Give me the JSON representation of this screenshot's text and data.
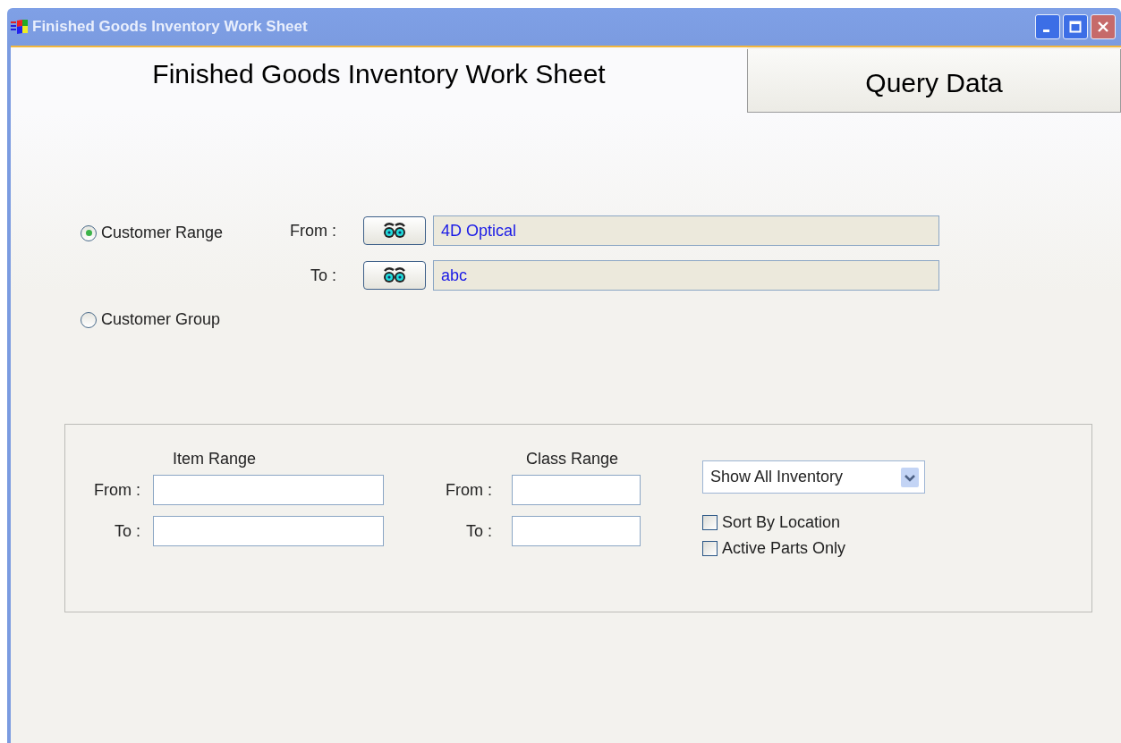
{
  "window": {
    "title": "Finished Goods Inventory Work Sheet"
  },
  "tabs": [
    {
      "label": "Finished Goods Inventory Work Sheet",
      "selected": true
    },
    {
      "label": "Query Data",
      "selected": false
    }
  ],
  "customer_options": [
    {
      "label": "Customer Range",
      "selected": true
    },
    {
      "label": "Customer Group",
      "selected": false
    }
  ],
  "customer_range": {
    "from_label": "From :",
    "from_value": "4D Optical",
    "to_label": "To :",
    "to_value": "abc"
  },
  "item_range": {
    "title": "Item Range",
    "from_label": "From :",
    "to_label": "To :"
  },
  "class_range": {
    "title": "Class Range",
    "from_label": "From :",
    "to_label": "To :"
  },
  "inventory_filter": {
    "value": "Show All Inventory"
  },
  "checkboxes": [
    {
      "label": "Sort By Location",
      "checked": false
    },
    {
      "label": "Active Parts Only",
      "checked": false
    }
  ]
}
